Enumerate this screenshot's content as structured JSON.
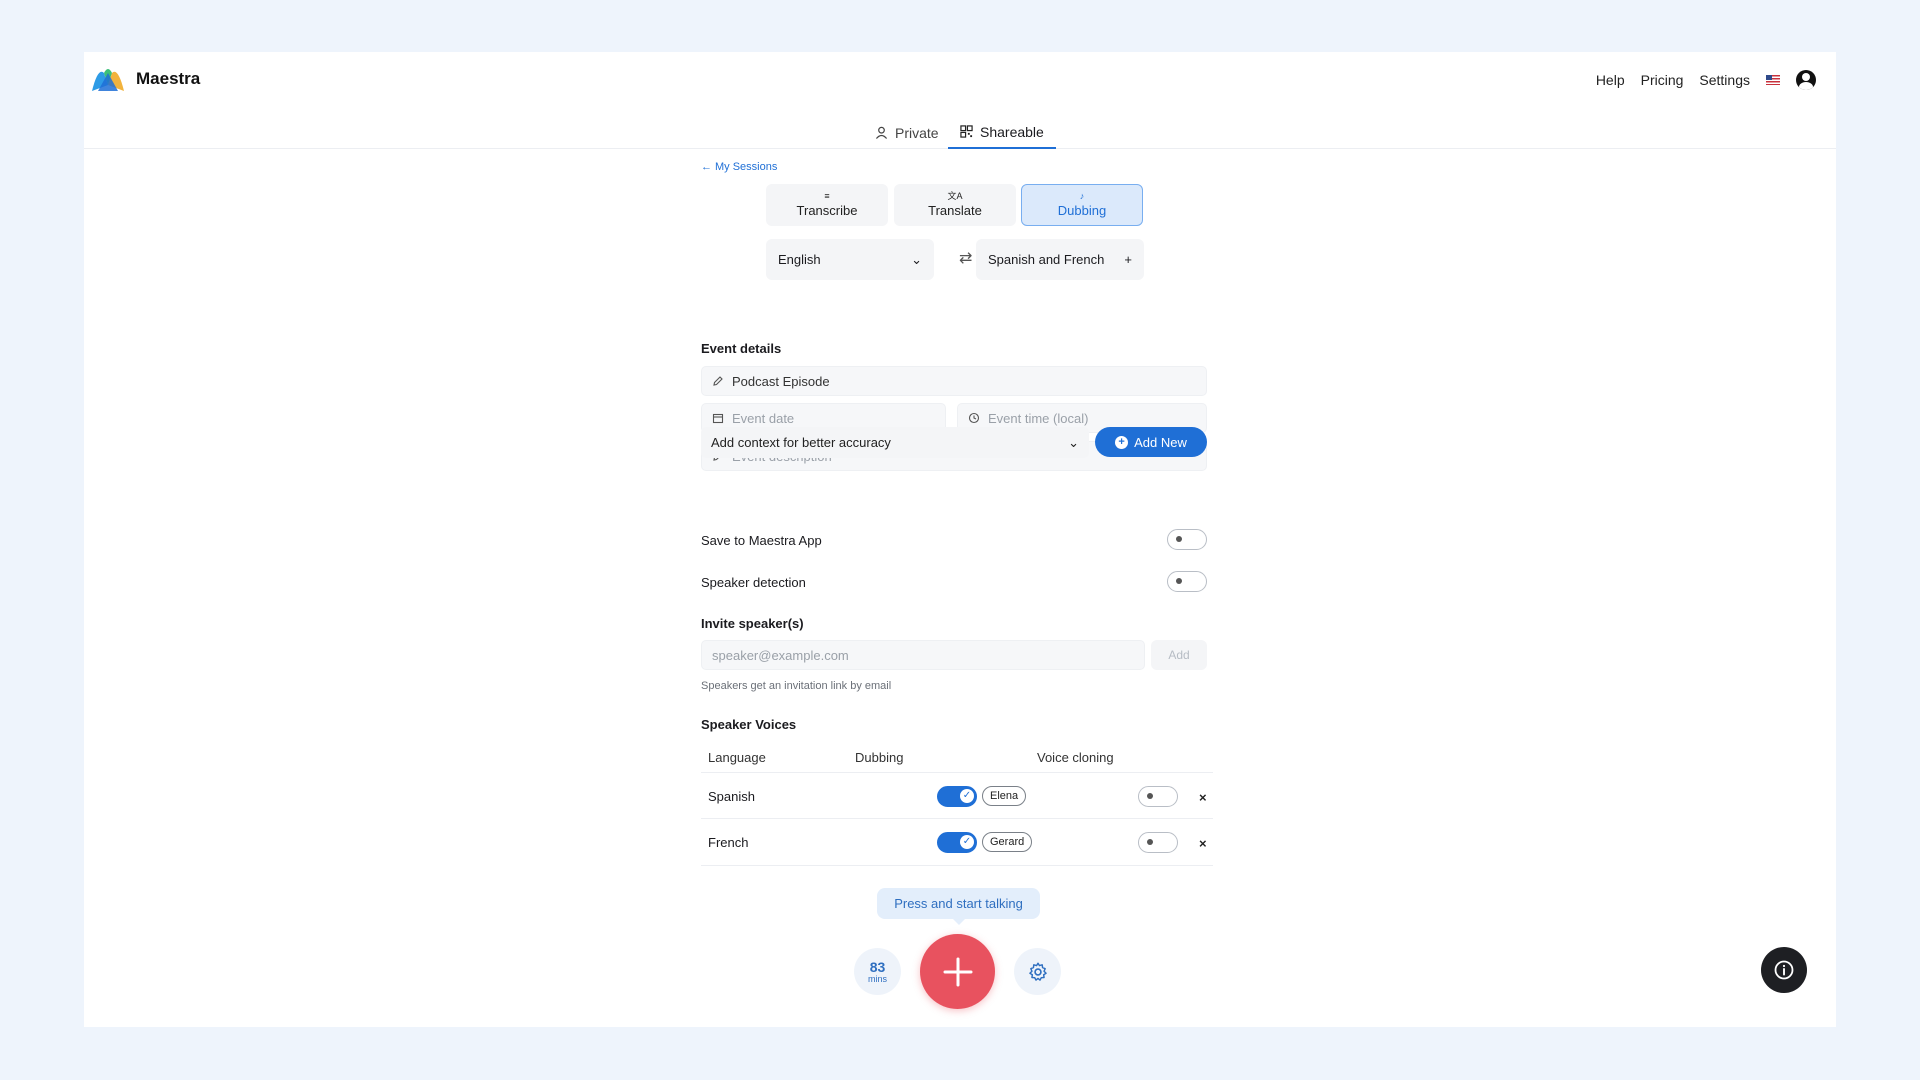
{
  "app": {
    "name": "Maestra"
  },
  "topnav": {
    "help": "Help",
    "pricing": "Pricing",
    "settings": "Settings"
  },
  "modes": {
    "private": "Private",
    "shareable": "Shareable"
  },
  "back_link": "My Sessions",
  "segments": {
    "transcribe": "Transcribe",
    "translate": "Translate",
    "dubbing": "Dubbing"
  },
  "languages": {
    "source": "English",
    "target": "Spanish and French"
  },
  "event": {
    "heading": "Event details",
    "name_value": "Podcast Episode",
    "date_placeholder": "Event date",
    "time_placeholder": "Event time (local)",
    "description_placeholder": "Event description",
    "context_label": "Add context for better accuracy",
    "add_new_label": "Add New"
  },
  "toggles": {
    "save_to_app": {
      "label": "Save to Maestra App",
      "on": false
    },
    "speaker_detection": {
      "label": "Speaker detection",
      "on": false
    }
  },
  "invite": {
    "heading": "Invite speaker(s)",
    "email_placeholder": "speaker@example.com",
    "add_label": "Add",
    "hint": "Speakers get an invitation link by email"
  },
  "voices": {
    "heading": "Speaker Voices",
    "columns": [
      "Language",
      "Dubbing",
      "Voice cloning"
    ],
    "rows": [
      {
        "language": "Spanish",
        "dubbing_on": true,
        "voice": "Elena",
        "cloning_on": false
      },
      {
        "language": "French",
        "dubbing_on": true,
        "voice": "Gerard",
        "cloning_on": false
      }
    ]
  },
  "recorder": {
    "tooltip": "Press and start talking",
    "minutes": "83",
    "minutes_unit": "mins"
  },
  "colors": {
    "accent": "#1f6fd6",
    "record": "#e8525f",
    "background": "#eef4fc"
  }
}
